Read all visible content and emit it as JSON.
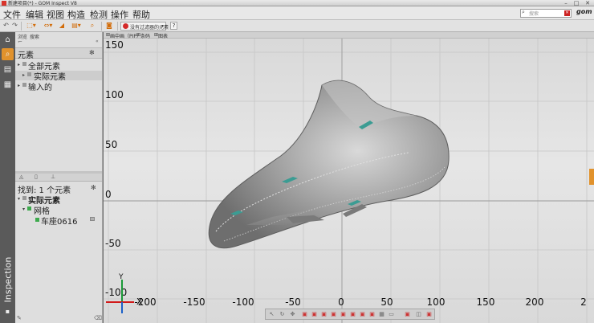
{
  "window": {
    "title": "新建项目(*) - GOM Inspect V8",
    "controls": [
      "–",
      "□",
      "✕"
    ]
  },
  "menu": [
    "文件",
    "编辑",
    "视图",
    "构造",
    "检测",
    "操作",
    "帮助"
  ],
  "search": {
    "placeholder": "搜索",
    "icon": "search-icon"
  },
  "logo": "gom",
  "toolbar": {
    "actual_label": "没有过滤器的元素",
    "help_label": "?"
  },
  "sidebar": {
    "workspace_label": "Inspection",
    "icons": [
      "home-icon",
      "search-icon",
      "document-icon",
      "grid-icon"
    ]
  },
  "explorer": {
    "tabs": [
      "浏览",
      "搜索"
    ],
    "header": "元素",
    "tree": [
      {
        "label": "全部元素",
        "expander": "▸"
      },
      {
        "label": "实际元素",
        "expander": "▸"
      },
      {
        "label": "输入的",
        "expander": "▸"
      }
    ],
    "found": "找到: 1 个元素",
    "results": [
      {
        "label": "实际元素",
        "expander": "▾"
      },
      {
        "label": "网格",
        "expander": "▾"
      },
      {
        "label": "车座0616"
      }
    ]
  },
  "viewport": {
    "tabs": [
      "画中画（PIP）",
      "条码",
      "图表"
    ],
    "y_ticks": [
      "150",
      "100",
      "50",
      "0",
      "-50",
      "-100"
    ],
    "x_ticks": [
      "-200",
      "-150",
      "-100",
      "-50",
      "0",
      "50",
      "100",
      "150",
      "200",
      "2"
    ],
    "axis_x": "X",
    "axis_y": "Y"
  },
  "colors": {
    "accent": "#e1922c",
    "axis_x": "#d11a1a",
    "axis_y": "#1b9a38",
    "accent_teal": "#3b9c93"
  }
}
